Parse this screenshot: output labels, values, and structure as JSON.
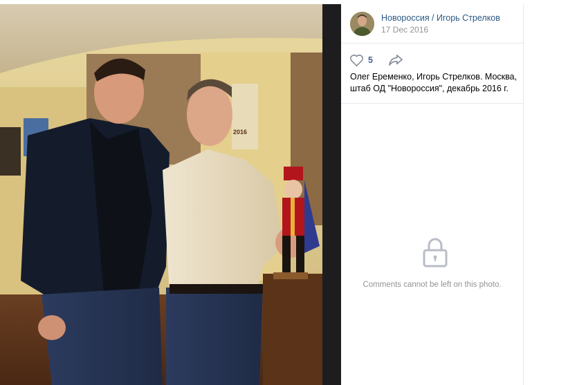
{
  "post": {
    "author": "Новороссия / Игорь Стрелков",
    "date": "17 Dec 2016",
    "likes": "5",
    "caption_line1": "Олег Еременко, Игорь Стрелков. Москва,",
    "caption_line2": "штаб ОД \"Новороссия\", декабрь 2016 г."
  },
  "comments": {
    "disabled_text": "Comments cannot be left on this photo."
  },
  "photo": {
    "calendar_text": "2016"
  },
  "icons": {
    "like": "heart-icon",
    "share": "share-arrow-icon",
    "lock": "lock-icon"
  },
  "colors": {
    "link": "#2a5885",
    "muted": "#939393",
    "icon": "#828a99",
    "divider": "#e7e8ec"
  }
}
